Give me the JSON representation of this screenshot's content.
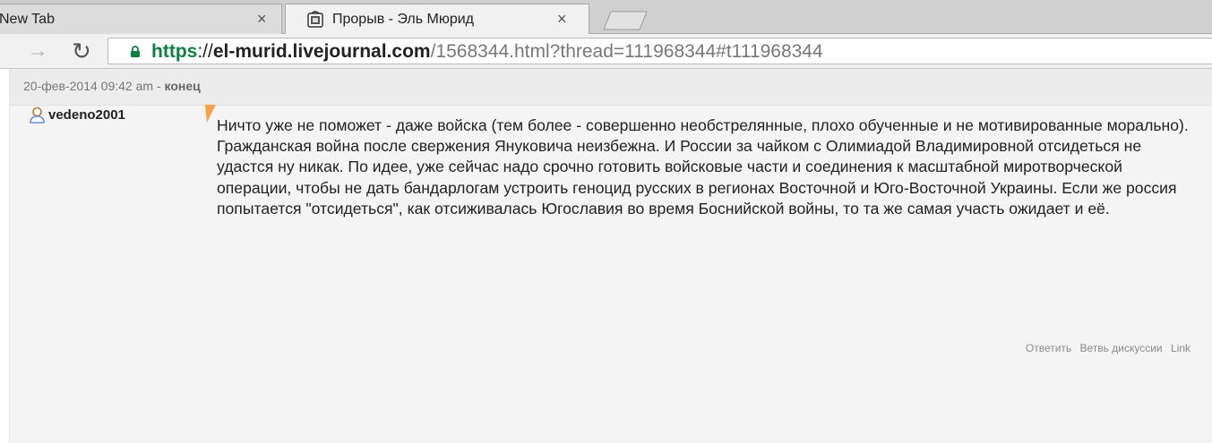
{
  "browser": {
    "tabs": [
      {
        "title": "New Tab",
        "close_label": "×",
        "active": false
      },
      {
        "title": "Прорыв - Эль Мюрид",
        "close_label": "×",
        "active": true
      }
    ],
    "toolbar": {
      "forward_icon": "forward-arrow-icon",
      "reload_icon": "reload-icon"
    },
    "url": {
      "scheme": "https",
      "separator": "://",
      "host": "el-murid.livejournal.com",
      "path": "/1568344.html?thread=111968344#t111968344"
    }
  },
  "comment": {
    "date": "20-фев-2014 09:42 am",
    "separator": " - ",
    "subject": "конец",
    "author": "vedeno2001",
    "text": "Ничто уже не поможет - даже войска (тем более - совершенно необстрелянные, плохо обученные и не мотивированные морально). Гражданская война после свержения Януковича неизбежна. И России за чайком с Олимиадой Владимировной отсидеться не удастся ну никак. По идее, уже сейчас надо срочно готовить войсковые части и соединения к масштабной миротворческой операции, чтобы не дать бандарлогам устроить геноцид русских в регионах Восточной и Юго-Восточной Украины. Если же россия попытается \"отсидеться\", как отсиживалась Югославия во время Боснийской войны, то та же самая участь ожидает и её.",
    "actions": {
      "reply": "Ответить",
      "thread": "Ветвь дискуссии",
      "link": "Link"
    }
  },
  "colors": {
    "secure_green": "#0b8043",
    "marker_orange": "#f7a14a",
    "user_icon_brown": "#b07a3c",
    "tab_strip": "#cfcfcf"
  }
}
